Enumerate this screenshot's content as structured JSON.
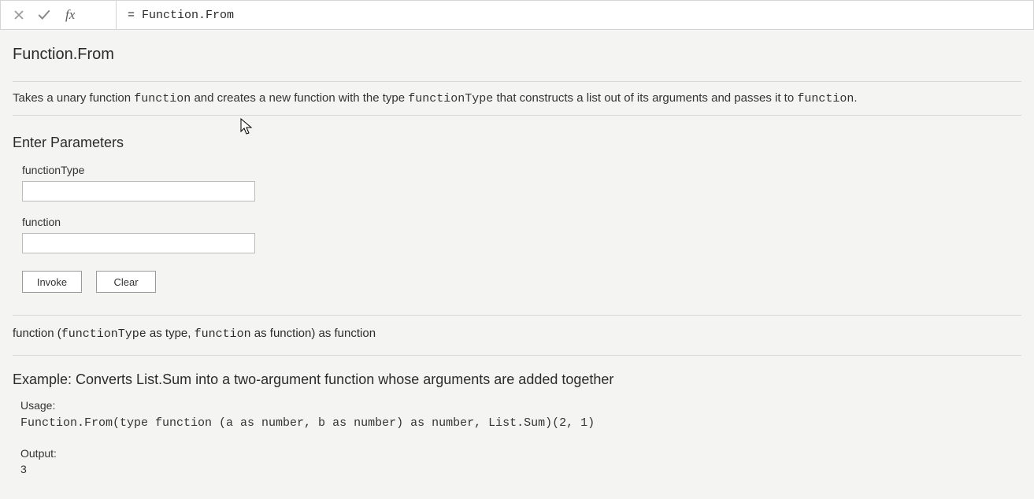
{
  "formulaBar": {
    "value": "= Function.From"
  },
  "doc": {
    "title": "Function.From",
    "desc": {
      "p1": "Takes a unary function ",
      "code1": "function",
      "p2": " and creates a new function with the type ",
      "code2": "functionType",
      "p3": " that constructs a list out of its arguments and passes it to ",
      "code3": "function",
      "p4": "."
    }
  },
  "params": {
    "heading": "Enter Parameters",
    "items": [
      {
        "label": "functionType",
        "value": ""
      },
      {
        "label": "function",
        "value": ""
      }
    ],
    "buttons": {
      "invoke": "Invoke",
      "clear": "Clear"
    }
  },
  "signature": {
    "pre": "function (",
    "a1": "functionType",
    "mid1": " as type, ",
    "a2": "function",
    "mid2": " as function) as function"
  },
  "example": {
    "heading": "Example: Converts List.Sum into a two-argument function whose arguments are added together",
    "usageLabel": "Usage:",
    "usageCode": "Function.From(type function (a as number, b as number) as number, List.Sum)(2, 1)",
    "outputLabel": "Output:",
    "outputValue": "3"
  }
}
